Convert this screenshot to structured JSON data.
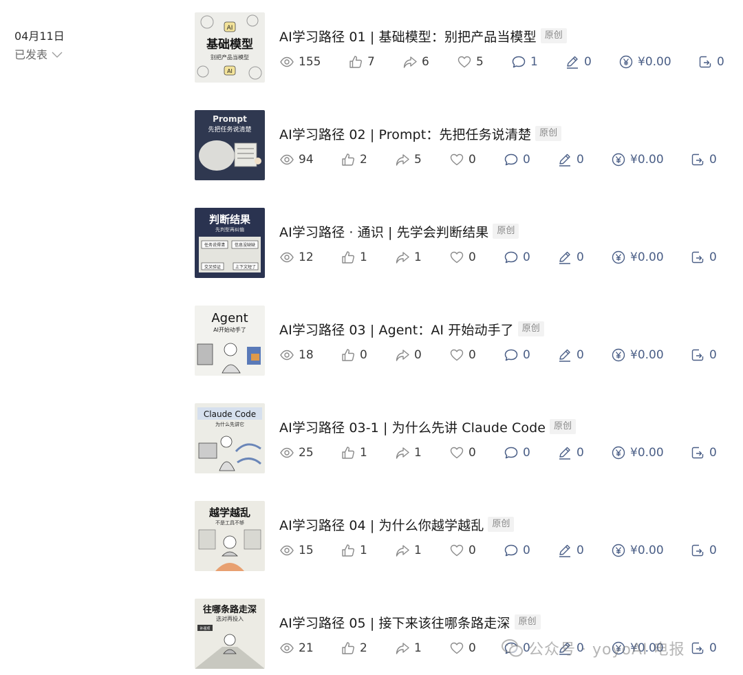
{
  "date_group": {
    "date": "04月11日",
    "status_label": "已发表"
  },
  "colors": {
    "accent": "#4a5e86",
    "muted": "#8a8a8a",
    "badge_bg": "#f2f2f2"
  },
  "articles": [
    {
      "title": "AI学习路径 01 | 基础模型：别把产品当模型",
      "badge": "原创",
      "thumb": {
        "main": "基础模型",
        "sub": "别把产品当模型",
        "tag": "AI",
        "tag2": "AI"
      },
      "stats": {
        "reads": "155",
        "likes": "7",
        "shares": "6",
        "favorites": "5",
        "comments": "1",
        "notes": "0",
        "reward": "¥0.00",
        "forwards": "0"
      }
    },
    {
      "title": "AI学习路径 02 | Prompt：先把任务说清楚",
      "badge": "原创",
      "thumb": {
        "main": "Prompt",
        "sub": "先把任务说清楚"
      },
      "stats": {
        "reads": "94",
        "likes": "2",
        "shares": "5",
        "favorites": "0",
        "comments": "0",
        "notes": "0",
        "reward": "¥0.00",
        "forwards": "0"
      }
    },
    {
      "title": "AI学习路径 · 通识 | 先学会判断结果",
      "badge": "原创",
      "thumb": {
        "main": "判断结果",
        "sub": "先判型再纠偏",
        "b1": "任务说得清",
        "b2": "信息没缺缺",
        "b3": "交叉验证",
        "b4": "上下文短了"
      },
      "stats": {
        "reads": "12",
        "likes": "1",
        "shares": "1",
        "favorites": "0",
        "comments": "0",
        "notes": "0",
        "reward": "¥0.00",
        "forwards": "0"
      }
    },
    {
      "title": "AI学习路径 03 | Agent：AI 开始动手了",
      "badge": "原创",
      "thumb": {
        "main": "Agent",
        "sub": "AI开始动手了"
      },
      "stats": {
        "reads": "18",
        "likes": "0",
        "shares": "0",
        "favorites": "0",
        "comments": "0",
        "notes": "0",
        "reward": "¥0.00",
        "forwards": "0"
      }
    },
    {
      "title": "AI学习路径 03-1 | 为什么先讲 Claude Code",
      "badge": "原创",
      "thumb": {
        "main": "Claude Code",
        "sub": "为什么先讲它"
      },
      "stats": {
        "reads": "25",
        "likes": "1",
        "shares": "1",
        "favorites": "0",
        "comments": "0",
        "notes": "0",
        "reward": "¥0.00",
        "forwards": "0"
      }
    },
    {
      "title": "AI学习路径 04 | 为什么你越学越乱",
      "badge": "原创",
      "thumb": {
        "main": "越学越乱",
        "sub": "不是工具不够"
      },
      "stats": {
        "reads": "15",
        "likes": "1",
        "shares": "1",
        "favorites": "0",
        "comments": "0",
        "notes": "0",
        "reward": "¥0.00",
        "forwards": "0"
      }
    },
    {
      "title": "AI学习路径 05 | 接下来该往哪条路走深",
      "badge": "原创",
      "thumb": {
        "main": "往哪条路走深",
        "sub": "选对再投入",
        "b1": "补强项"
      },
      "stats": {
        "reads": "21",
        "likes": "2",
        "shares": "1",
        "favorites": "0",
        "comments": "0",
        "notes": "0",
        "reward": "¥0.00",
        "forwards": "0"
      }
    }
  ],
  "watermark": {
    "text": "公众号 · yoyoAI 电报"
  }
}
